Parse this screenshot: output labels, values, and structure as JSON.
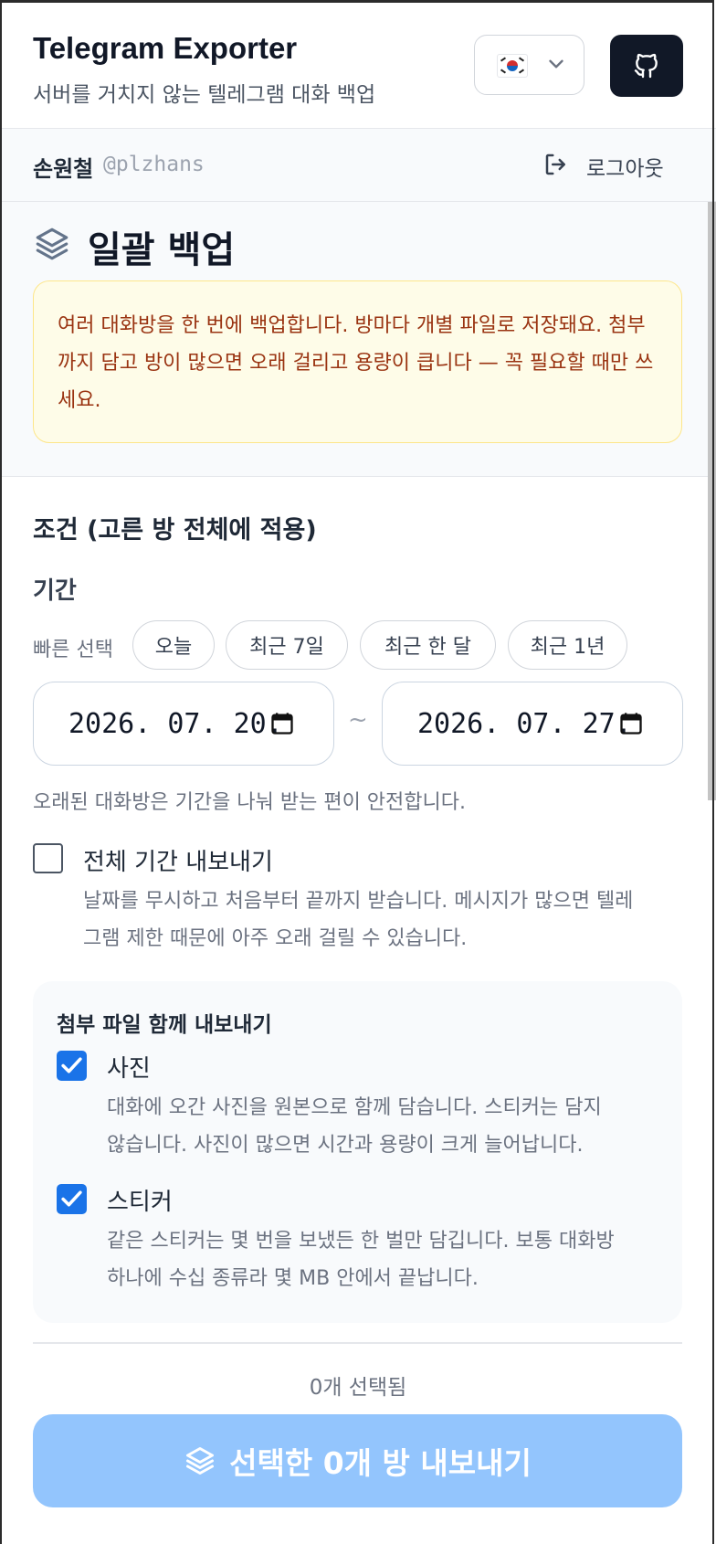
{
  "header": {
    "title": "Telegram Exporter",
    "subtitle": "서버를 거치지 않는 텔레그램 대화 백업",
    "language_icon": "kr-flag-icon",
    "github_icon": "github-icon"
  },
  "user": {
    "name": "손원철",
    "handle": "@plzhans",
    "logout_label": "로그아웃"
  },
  "section": {
    "title": "일괄 백업",
    "warning": "여러 대화방을 한 번에 백업합니다. 방마다 개별 파일로 저장돼요. 첨부까지 담고 방이 많으면 오래 걸리고 용량이 큽니다 — 꼭 필요할 때만 쓰세요."
  },
  "conditions": {
    "title": "조건 (고른 방 전체에 적용)",
    "period_label": "기간",
    "quick_label": "빠른 선택",
    "quick_chips": [
      "오늘",
      "최근 7일",
      "최근 한 달",
      "최근 1년"
    ],
    "date_from": "2026. 07. 20.",
    "date_to": "2026. 07. 27.",
    "date_separator": "~",
    "date_hint": "오래된 대화방은 기간을 나눠 받는 편이 안전합니다.",
    "full_period": {
      "checked": false,
      "label": "전체 기간 내보내기",
      "desc_line1": "날짜를 무시하고 처음부터 끝까지 받습니다. 메시지가 많으면 텔레",
      "desc_line2": "그램 제한 때문에 아주 오래 걸릴 수 있습니다."
    }
  },
  "attachments": {
    "title": "첨부 파일 함께 내보내기",
    "photo": {
      "checked": true,
      "label": "사진",
      "desc_line1": "대화에 오간 사진을 원본으로 함께 담습니다. 스티커는 담지",
      "desc_line2": "않습니다. 사진이 많으면 시간과 용량이 크게 늘어납니다."
    },
    "sticker": {
      "checked": true,
      "label": "스티커",
      "desc_line1": "같은 스티커는 몇 번을 보냈든 한 벌만 담깁니다. 보통 대화방",
      "desc_line2": "하나에 수십 종류라 몇 MB 안에서 끝납니다."
    }
  },
  "footer": {
    "selected_count": "0개 선택됨",
    "export_label": "선택한 0개 방 내보내기"
  },
  "colors": {
    "accent": "#1a73e8",
    "export_disabled": "#93c5fd",
    "warning_bg": "#fefce8",
    "warning_text": "#9a3412"
  }
}
